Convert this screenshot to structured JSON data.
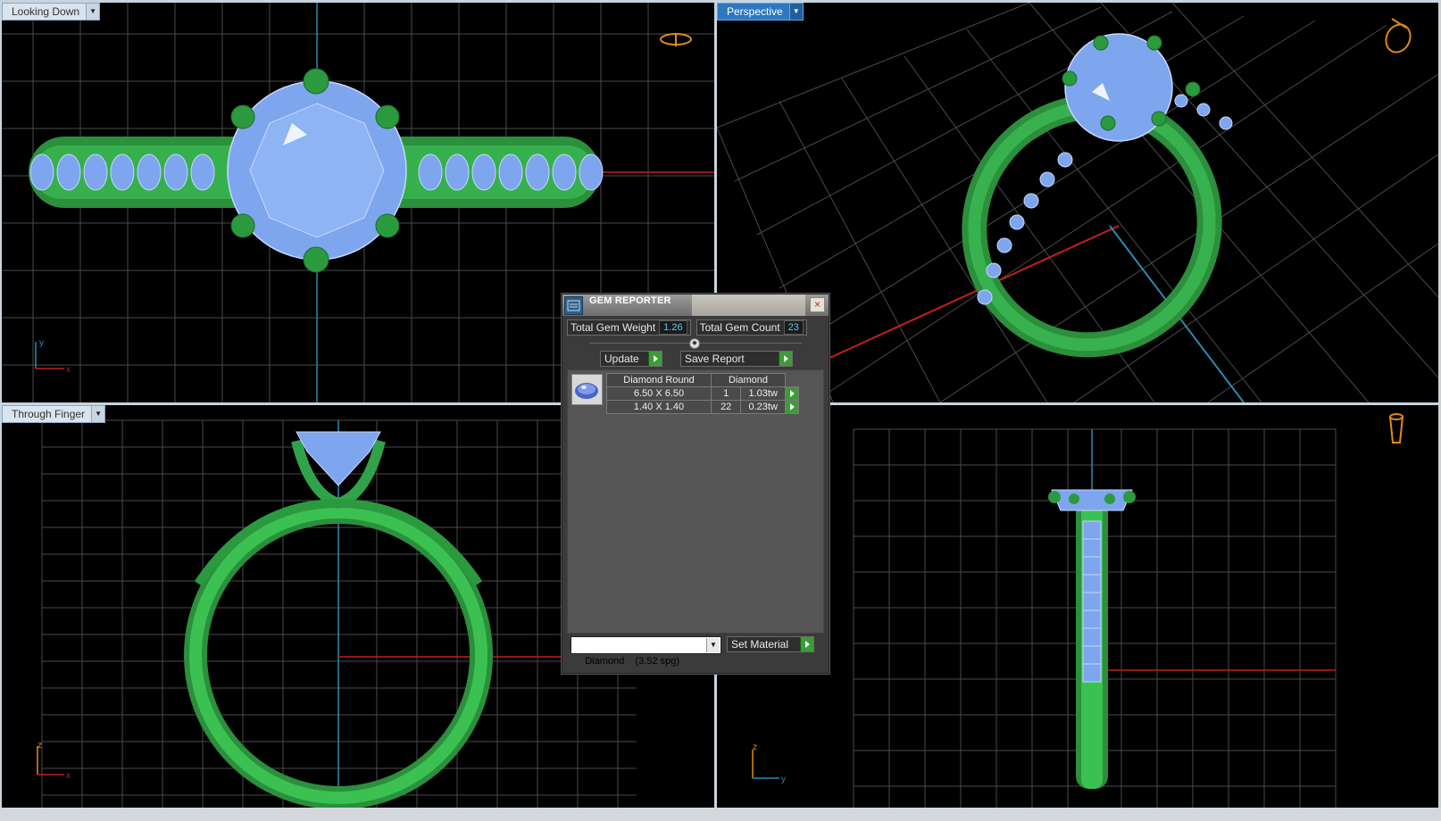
{
  "viewports": {
    "top_left": {
      "label": "Looking Down",
      "axes": {
        "a": "y",
        "b": "x"
      }
    },
    "top_right": {
      "label": "Perspective"
    },
    "bottom_left": {
      "label": "Through Finger",
      "axes": {
        "a": "z",
        "b": "x"
      }
    },
    "bottom_right": {
      "axes": {
        "a": "z",
        "b": "y"
      }
    }
  },
  "dialog": {
    "title": "GEM REPORTER",
    "close_glyph": "×",
    "total_weight_label": "Total Gem Weight",
    "total_weight_value": "1.26",
    "total_count_label": "Total Gem Count",
    "total_count_value": "23",
    "separator_glyph": "◆",
    "update_label": "Update",
    "save_label": "Save Report",
    "table": {
      "headers": [
        "Diamond Round",
        "Diamond"
      ],
      "rows": [
        {
          "size": "6.50 X 6.50",
          "count": "1",
          "weight": "1.03tw"
        },
        {
          "size": "1.40 X 1.40",
          "count": "22",
          "weight": "0.23tw"
        }
      ]
    },
    "material_select": "Diamond    (3.52 spg)",
    "set_material_label": "Set Material"
  },
  "colors": {
    "metal": "#2fa24a",
    "gem": "#7ea6ee",
    "grid": "#4a4a4a",
    "axis_red": "#c0201c",
    "axis_blue": "#2a8ab0",
    "accent": "#2d78c2"
  },
  "icons": [
    "dropdown-arrow-icon",
    "ring-orientation-icon",
    "gem-reporter-icon",
    "gem-diamond-icon",
    "go-arrow-icon"
  ]
}
